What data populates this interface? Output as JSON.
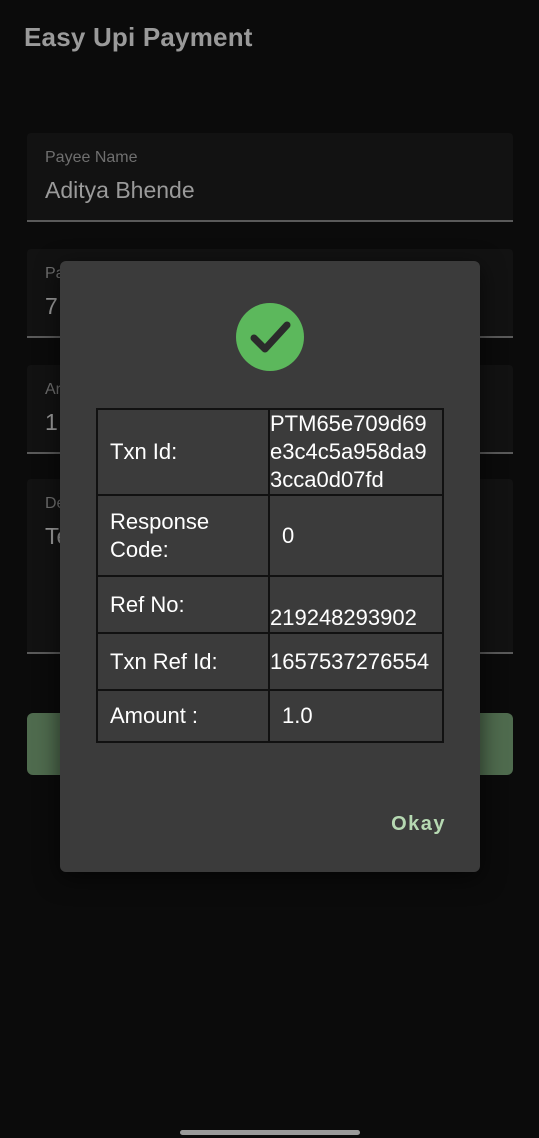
{
  "app": {
    "title": "Easy Upi Payment"
  },
  "form": {
    "payee_name_label": "Payee Name",
    "payee_name_value": "Aditya Bhende",
    "field2_label": "Pa",
    "field2_value": "7",
    "field3_label": "Ar",
    "field3_value": "1",
    "field4_label": "De",
    "field4_value": "Te"
  },
  "dialog": {
    "status_icon": "check-circle-icon",
    "rows": [
      {
        "key": "Txn Id:",
        "value": "PTM65e709d69e3c4c5a958da93cca0d07fd"
      },
      {
        "key": "Response Code:",
        "value": "0"
      },
      {
        "key": "Ref No:",
        "value": "219248293902"
      },
      {
        "key": "Txn Ref Id:",
        "value": "1657537276554"
      },
      {
        "key": "Amount :",
        "value": "1.0"
      }
    ],
    "okay_label": "Okay"
  },
  "colors": {
    "success": "#5cb85c",
    "button": "#4f6b4e",
    "accent_text": "#b6d9b2",
    "dialog_bg": "#3b3b3b"
  }
}
